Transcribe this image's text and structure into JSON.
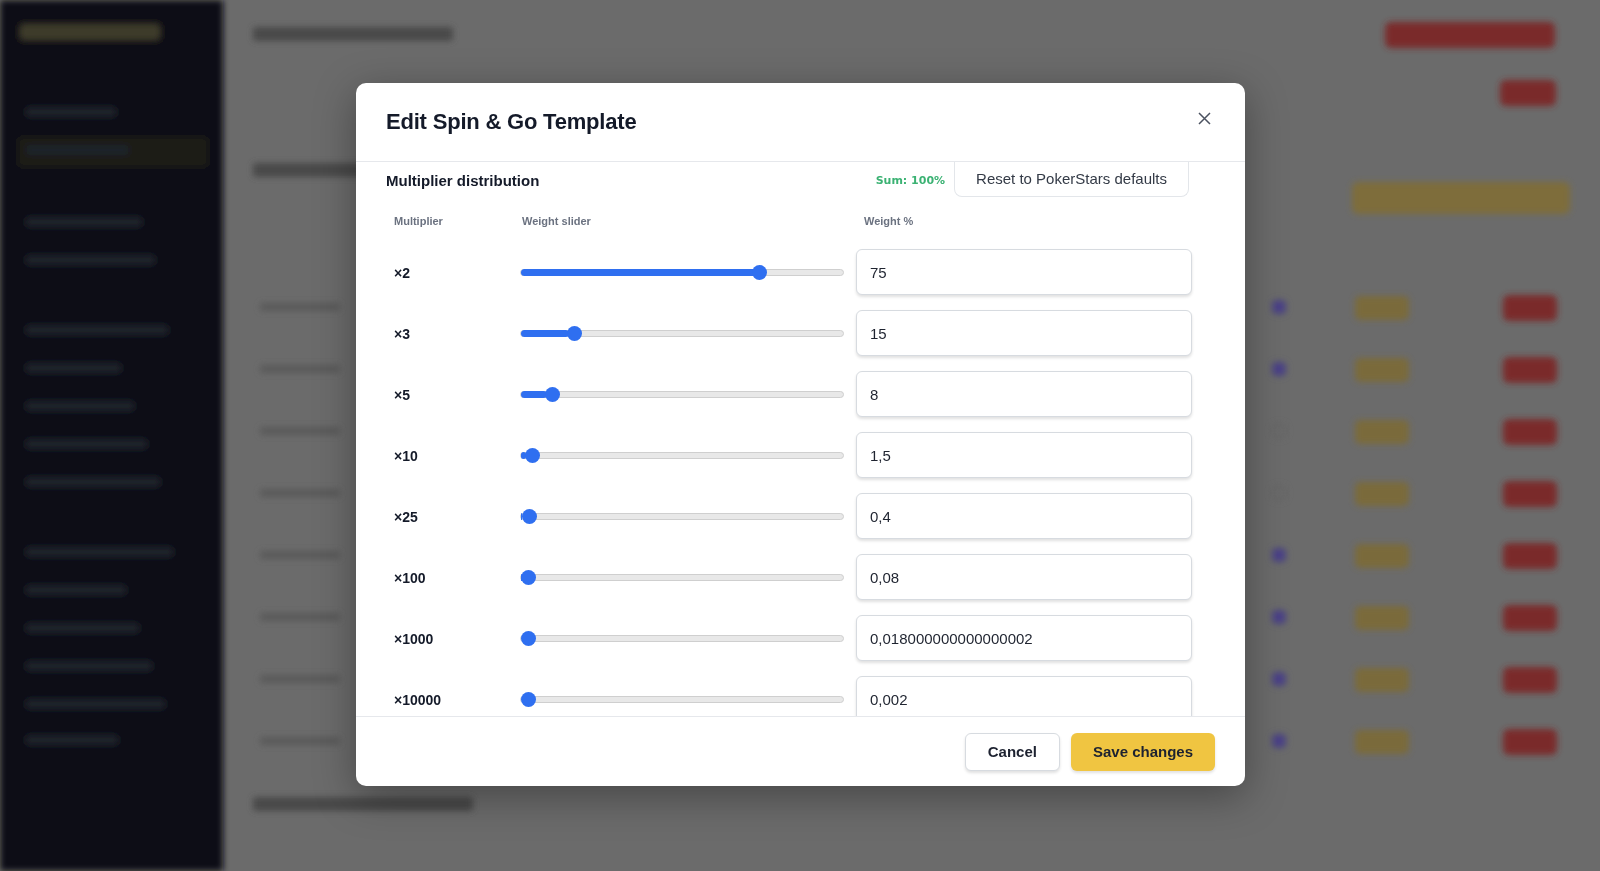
{
  "dialog": {
    "title": "Edit Spin & Go Template",
    "section": {
      "title": "Multiplier distribution",
      "sum": "Sum: 100%",
      "sum_ok": true,
      "reset_button": "Reset to PokerStars defaults"
    },
    "columns": [
      "Multiplier",
      "Weight slider",
      "Weight %"
    ],
    "rows": [
      {
        "multiplier": "×2",
        "level": 0.75,
        "weight": "75"
      },
      {
        "multiplier": "×3",
        "level": 0.15,
        "weight": "15"
      },
      {
        "multiplier": "×5",
        "level": 0.08,
        "weight": "8"
      },
      {
        "multiplier": "×10",
        "level": 0.015,
        "weight": "1,5"
      },
      {
        "multiplier": "×25",
        "level": 0.004,
        "weight": "0,4"
      },
      {
        "multiplier": "×100",
        "level": 0.0008,
        "weight": "0,08"
      },
      {
        "multiplier": "×1000",
        "level": 0.00018,
        "weight": "0,018000000000000002"
      },
      {
        "multiplier": "×10000",
        "level": 2e-05,
        "weight": "0,002"
      }
    ],
    "buttons": [
      {
        "label": "Cancel",
        "kind": "secondary"
      },
      {
        "label": "Save changes",
        "kind": "primary"
      }
    ]
  }
}
